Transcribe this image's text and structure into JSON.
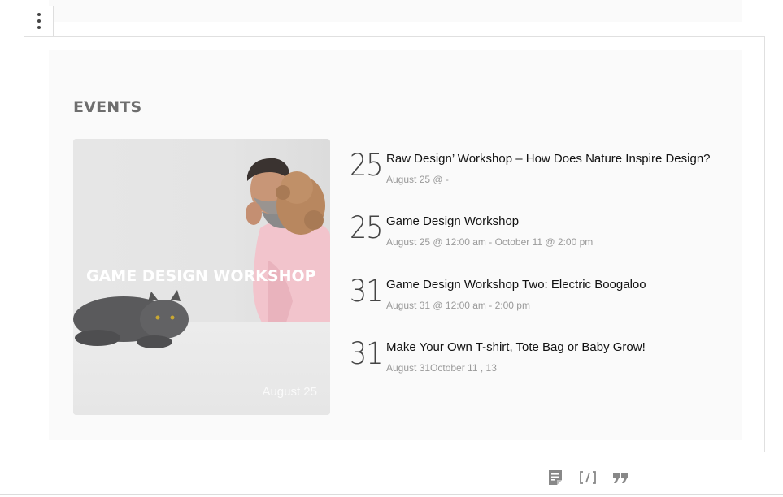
{
  "block_menu": {
    "icon": "more-vertical-icon"
  },
  "section": {
    "heading": "EVENTS"
  },
  "featured": {
    "title": "GAME DESIGN WORKSHOP",
    "date": "August 25",
    "image": "man-with-dog-and-cat-photo"
  },
  "events": [
    {
      "day": "25",
      "title": "Raw Design’ Workshop – How Does Nature Inspire Design?",
      "meta": "August 25 @ -"
    },
    {
      "day": "25",
      "title": "Game Design Workshop",
      "meta": "August 25 @ 12:00 am - October 11 @ 2:00 pm"
    },
    {
      "day": "31",
      "title": "Game Design Workshop Two: Electric Boogaloo",
      "meta": "August 31 @ 12:00 am - 2:00 pm"
    },
    {
      "day": "31",
      "title": "Make Your Own T-shirt, Tote Bag or Baby Grow!",
      "meta": "August 31October 11 , 13"
    }
  ],
  "toolbar": {
    "icons": [
      "paragraph-icon",
      "shortcode-icon",
      "quote-icon"
    ]
  },
  "colors": {
    "heading": "#6e6e6e",
    "meta": "#9a9a9a",
    "panel": "#fafafa"
  }
}
